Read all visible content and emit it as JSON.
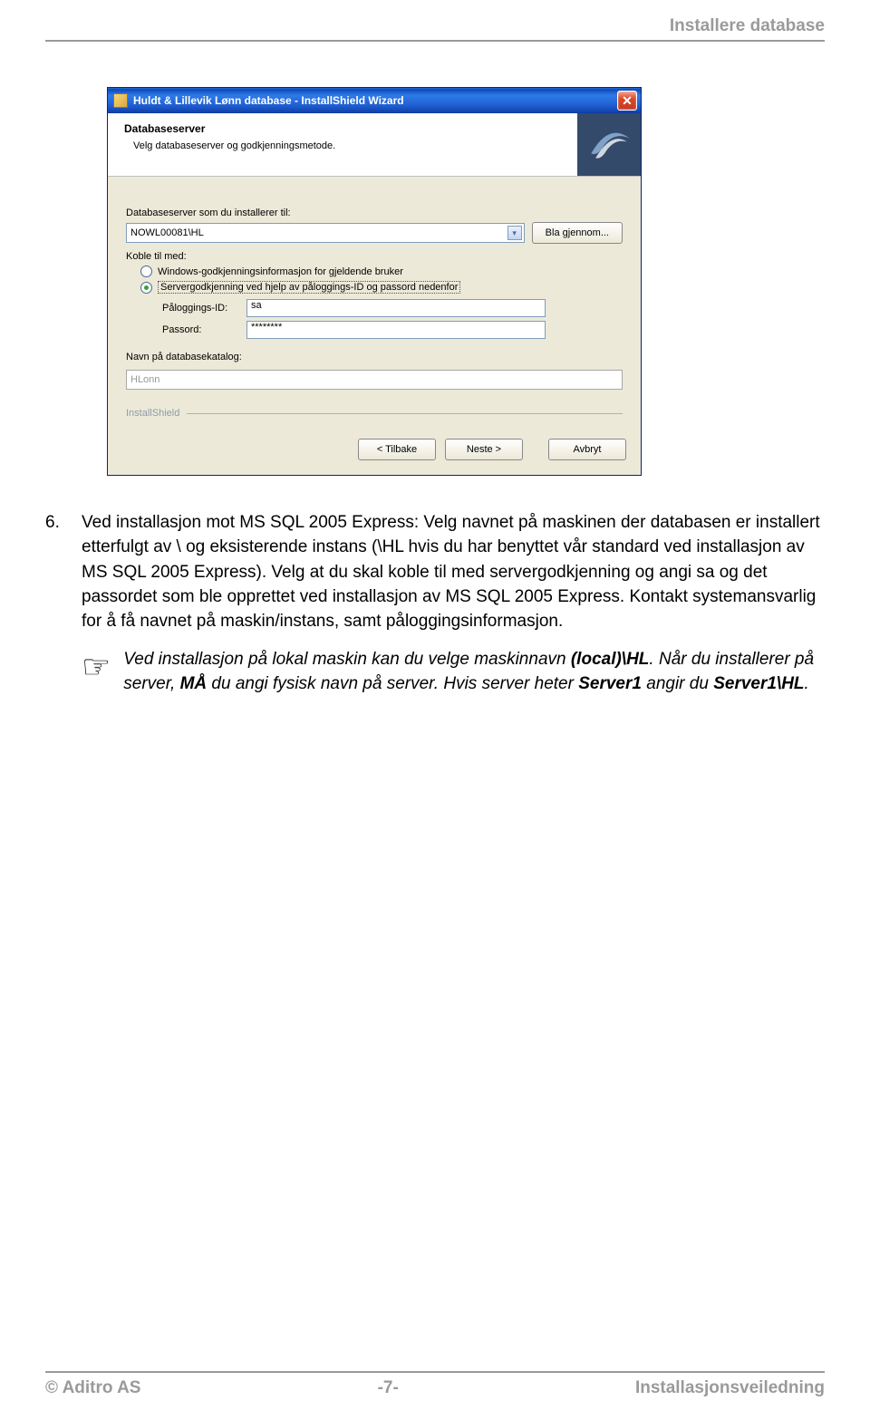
{
  "header": {
    "title": "Installere database"
  },
  "dialog": {
    "title": "Huldt & Lillevik Lønn database - InstallShield Wizard",
    "banner_title": "Databaseserver",
    "banner_sub": "Velg databaseserver og godkjenningsmetode.",
    "server_label": "Databaseserver som du installerer til:",
    "server_value": "NOWL00081\\HL",
    "browse_label": "Bla gjennom...",
    "connect_label": "Koble til med:",
    "radio1": "Windows-godkjenningsinformasjon for gjeldende bruker",
    "radio2": "Servergodkjenning ved hjelp av påloggings-ID og passord nedenfor",
    "login_label": "Påloggings-ID:",
    "login_value": "sa",
    "pwd_label": "Passord:",
    "pwd_value": "********",
    "catalog_label": "Navn på databasekatalog:",
    "catalog_value": "HLonn",
    "brand": "InstallShield",
    "back": "< Tilbake",
    "next": "Neste >",
    "cancel": "Avbryt"
  },
  "body": {
    "num": "6.",
    "p1": "Ved installasjon mot MS SQL 2005 Express: Velg navnet på maskinen der databasen er installert etterfulgt av \\ og eksisterende instans (\\HL hvis du har benyttet vår standard ved installasjon av MS SQL 2005 Express). Velg at du skal koble til med servergodkjenning og angi sa og det passordet som ble opprettet ved installasjon av MS SQL 2005 Express. Kontakt systemansvarlig for å få navnet på maskin/instans, samt påloggingsinformasjon.",
    "note1a": "Ved installasjon på lokal maskin kan du velge maskinnavn ",
    "note1b": "(local)\\HL",
    "note1c": ". Når du installerer på server, ",
    "note1d": "MÅ",
    "note1e": " du angi fysisk navn på server. Hvis server heter ",
    "note1f": "Server1",
    "note1g": " angir du ",
    "note1h": "Server1\\HL",
    "note1i": "."
  },
  "footer": {
    "left": "© Aditro AS",
    "center": "-7-",
    "right": "Installasjonsveiledning"
  }
}
